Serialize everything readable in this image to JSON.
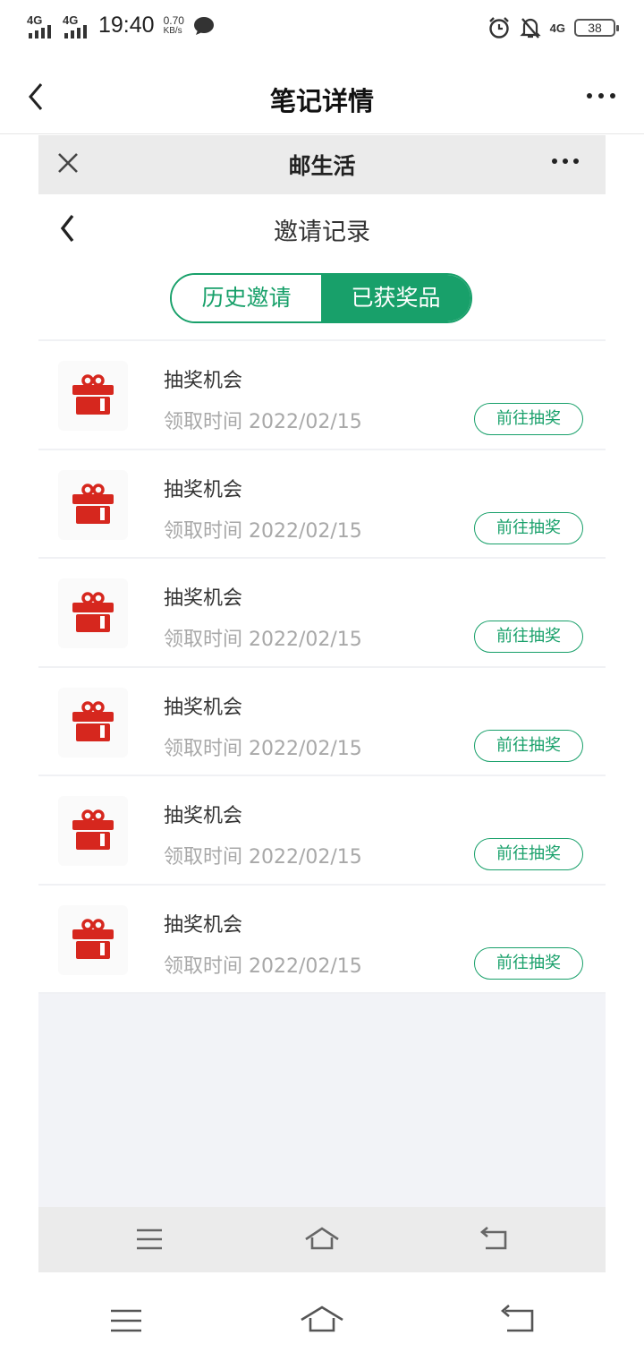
{
  "status_bar": {
    "signal1": "4G",
    "signal2": "4G",
    "time": "19:40",
    "speed_value": "0.70",
    "speed_unit": "KB/s",
    "network_right": "4G",
    "battery": "38"
  },
  "app_header": {
    "title": "笔记详情"
  },
  "mini_app": {
    "title": "邮生活",
    "page_title": "邀请记录",
    "tabs": [
      {
        "label": "历史邀请",
        "active": false
      },
      {
        "label": "已获奖品",
        "active": true
      }
    ],
    "accent_color": "#18a06a",
    "gift_color": "#d6271e",
    "items": [
      {
        "name": "抽奖机会",
        "time": "领取时间 2022/02/15",
        "button": "前往抽奖"
      },
      {
        "name": "抽奖机会",
        "time": "领取时间 2022/02/15",
        "button": "前往抽奖"
      },
      {
        "name": "抽奖机会",
        "time": "领取时间 2022/02/15",
        "button": "前往抽奖"
      },
      {
        "name": "抽奖机会",
        "time": "领取时间 2022/02/15",
        "button": "前往抽奖"
      },
      {
        "name": "抽奖机会",
        "time": "领取时间 2022/02/15",
        "button": "前往抽奖"
      },
      {
        "name": "抽奖机会",
        "time": "领取时间 2022/02/15",
        "button": "前往抽奖"
      }
    ]
  },
  "icons": {
    "back": "chevron-left-icon",
    "more": "more-dots-icon",
    "close": "close-icon",
    "gift": "gift-icon",
    "nav_menu": "menu-icon",
    "nav_home": "home-icon",
    "nav_back": "return-icon"
  }
}
